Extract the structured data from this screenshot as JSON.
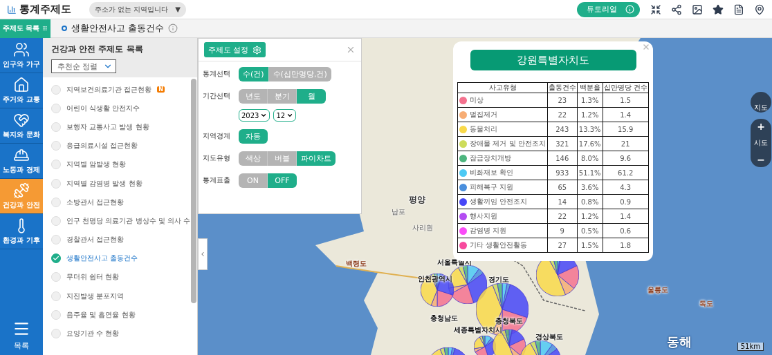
{
  "header": {
    "app_title": "통계주제도",
    "region_select": "주소가 없는 지역입니다",
    "region_caret": "▼",
    "tutorial_button": "튜토리얼"
  },
  "subbar": {
    "catalog_button": "주제도 목록",
    "current_title": "생활안전사고 출동건수"
  },
  "nav": {
    "items": [
      {
        "label": "인구와 가구",
        "kind": "people",
        "selected": false
      },
      {
        "label": "주거와 교통",
        "kind": "house",
        "selected": false
      },
      {
        "label": "복지와 문화",
        "kind": "welfare",
        "selected": false
      },
      {
        "label": "노동과 경제",
        "kind": "labor",
        "selected": false
      },
      {
        "label": "건강과 안전",
        "kind": "health",
        "selected": true
      },
      {
        "label": "환경과 기후",
        "kind": "climate",
        "selected": false
      }
    ],
    "menu_label": "목록"
  },
  "list_panel": {
    "title": "건강과 안전 주제도 목록",
    "sort_select": "추천순 정렬",
    "items": [
      {
        "label": "지역보건의료기관 접근현황",
        "selected": false,
        "badge": "N"
      },
      {
        "label": "어린이 식생활 안전지수",
        "selected": false
      },
      {
        "label": "보행자 교통사고 발생 현황",
        "selected": false
      },
      {
        "label": "응급의료시설 접근현황",
        "selected": false
      },
      {
        "label": "지역별 암발생 현황",
        "selected": false
      },
      {
        "label": "지역별 감염병 발생 현황",
        "selected": false
      },
      {
        "label": "소방관서 접근현황",
        "selected": false
      },
      {
        "label": "인구 천명당 의료기관 병상수 및 의사 수",
        "selected": false
      },
      {
        "label": "경찰관서 접근현황",
        "selected": false
      },
      {
        "label": "생활안전사고 출동건수",
        "selected": true
      },
      {
        "label": "무더위 쉼터 현황",
        "selected": false
      },
      {
        "label": "지진발생 분포지역",
        "selected": false
      },
      {
        "label": "음주율 및 흡연율 현황",
        "selected": false
      },
      {
        "label": "요양기관 수 현황",
        "selected": false
      }
    ]
  },
  "settings": {
    "title": "주제도 설정",
    "rows": [
      {
        "label": "통계선택",
        "kind": "segments",
        "options": [
          {
            "label": "수(건)",
            "selected": true
          },
          {
            "label": "수(십만명당,건)",
            "selected": false
          }
        ]
      },
      {
        "label": "기간선택",
        "kind": "segments",
        "options": [
          {
            "label": "년도",
            "selected": false
          },
          {
            "label": "분기",
            "selected": false
          },
          {
            "label": "월",
            "selected": true
          }
        ],
        "selects": [
          "2023",
          "12"
        ]
      },
      {
        "label": "지역경계",
        "kind": "segments",
        "options": [
          {
            "label": "자동",
            "selected": true
          }
        ]
      },
      {
        "label": "지도유형",
        "kind": "segments",
        "options": [
          {
            "label": "색상",
            "selected": false
          },
          {
            "label": "버블",
            "selected": false
          },
          {
            "label": "파이차트",
            "selected": true
          }
        ]
      },
      {
        "label": "통계표출",
        "kind": "segments",
        "options": [
          {
            "label": "ON",
            "selected": false
          },
          {
            "label": "OFF",
            "selected": true
          }
        ]
      }
    ]
  },
  "map": {
    "labels": [
      {
        "text": "평양",
        "kind": "city"
      },
      {
        "text": "남포",
        "kind": "minor"
      },
      {
        "text": "사리원",
        "kind": "minor"
      },
      {
        "text": "백령도",
        "kind": "island"
      },
      {
        "text": "서울특별시",
        "kind": "region"
      },
      {
        "text": "인천광역시",
        "kind": "region"
      },
      {
        "text": "경기도",
        "kind": "region"
      },
      {
        "text": "충청남도",
        "kind": "region"
      },
      {
        "text": "세종특별자치시",
        "kind": "region"
      },
      {
        "text": "충청북도",
        "kind": "region"
      },
      {
        "text": "경상북도",
        "kind": "region"
      },
      {
        "text": "울릉도",
        "kind": "island"
      },
      {
        "text": "독도",
        "kind": "island"
      },
      {
        "text": "동해",
        "kind": "sea"
      }
    ],
    "scale": "51km",
    "zoom_in": "+",
    "zoom_label": "시도",
    "zoom_out": "−",
    "map_button": "지도"
  },
  "popup": {
    "title": "강원특별자치도",
    "columns": [
      "사고유형",
      "출동건수",
      "백분율",
      "십만명당 건수"
    ],
    "rows": [
      {
        "type": "미상",
        "count": "23",
        "share": "1.3%",
        "per": "1.5",
        "color": "#f4728f"
      },
      {
        "type": "벌집제거",
        "count": "22",
        "share": "1.2%",
        "per": "1.4",
        "color": "#f7ad74"
      },
      {
        "type": "동물처리",
        "count": "243",
        "share": "13.3%",
        "per": "15.9",
        "color": "#f9d94a"
      },
      {
        "type": "장애물 제거 및 안전조치",
        "count": "321",
        "share": "17.6%",
        "per": "21",
        "color": "#cddc5a"
      },
      {
        "type": "잠금장치개방",
        "count": "146",
        "share": "8.0%",
        "per": "9.6",
        "color": "#4db57e"
      },
      {
        "type": "비화재보 확인",
        "count": "933",
        "share": "51.1%",
        "per": "61.2",
        "color": "#4cc9f4"
      },
      {
        "type": "피해복구 지원",
        "count": "65",
        "share": "3.6%",
        "per": "4.3",
        "color": "#4a8fdd"
      },
      {
        "type": "생활끼임 안전조치",
        "count": "14",
        "share": "0.8%",
        "per": "0.9",
        "color": "#4646f7"
      },
      {
        "type": "행사지원",
        "count": "22",
        "share": "1.2%",
        "per": "1.4",
        "color": "#b34cf2"
      },
      {
        "type": "감염병 지원",
        "count": "9",
        "share": "0.5%",
        "per": "0.6",
        "color": "#fa4df7"
      },
      {
        "type": "기타 생활안전활동",
        "count": "27",
        "share": "1.5%",
        "per": "1.8",
        "color": "#f74a9e"
      }
    ]
  }
}
